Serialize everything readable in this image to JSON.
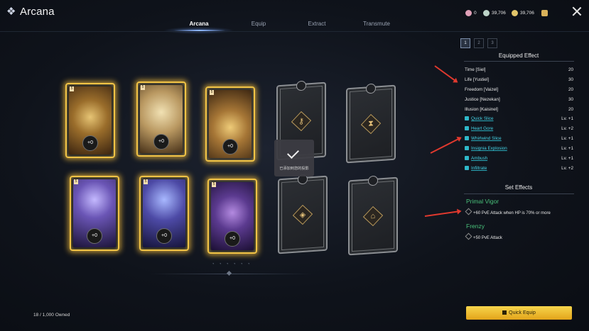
{
  "app": {
    "title": "Arcana"
  },
  "tabs": [
    "Arcana",
    "Equip",
    "Extract",
    "Transmute"
  ],
  "currencies": [
    {
      "icon": "crystal-icon",
      "value": "0",
      "color": "#e0a0b8"
    },
    {
      "icon": "silver-coin-icon",
      "value": "39,706",
      "color": "#bcd3c8"
    },
    {
      "icon": "gold-coin-icon",
      "value": "39,706",
      "color": "#e1c46a"
    },
    {
      "icon": "chest-icon",
      "value": "",
      "color": "#d9b25a"
    }
  ],
  "cards": {
    "row1": [
      {
        "plus": "+0",
        "badge": "5"
      },
      {
        "plus": "+0",
        "badge": "5"
      },
      {
        "plus": "+0",
        "badge": "5"
      }
    ],
    "row2": [
      {
        "plus": "+0",
        "badge": "5"
      },
      {
        "plus": "+0",
        "badge": "5"
      },
      {
        "plus": "+0",
        "badge": "5"
      }
    ]
  },
  "toast": {
    "text": "已添加到您的投影"
  },
  "owned": "18 / 1,000 Owned",
  "panel": {
    "pages": [
      "1",
      "2",
      "3"
    ],
    "equipped_title": "Equipped Effect",
    "stats": [
      {
        "name": "Time [Siel]",
        "value": "20"
      },
      {
        "name": "Life [Yustiel]",
        "value": "30"
      },
      {
        "name": "Freedom [Vaizel]",
        "value": "20"
      },
      {
        "name": "Justice [Nezekan]",
        "value": "30"
      },
      {
        "name": "Illusion [Kaisinel]",
        "value": "20"
      }
    ],
    "skills": [
      {
        "name": "Quick Slice",
        "level": "Lv. +1"
      },
      {
        "name": "Heart Gore",
        "level": "Lv. +2"
      },
      {
        "name": "Whirlwind Slice",
        "level": "Lv. +1"
      },
      {
        "name": "Insignia Explosion",
        "level": "Lv. +1"
      },
      {
        "name": "Ambush",
        "level": "Lv. +1"
      },
      {
        "name": "Infiltrate",
        "level": "Lv. +2"
      }
    ],
    "set_title": "Set Effects",
    "sets": [
      {
        "name": "Primal Vigor",
        "desc": "+60 PvE Attack when HP is 70% or more"
      },
      {
        "name": "Frenzy",
        "desc": "+50 PvE Attack"
      }
    ],
    "quick_equip": "Quick Equip"
  },
  "colors": {
    "accent_gold": "#f2c446",
    "skill_cyan": "#45d4e6",
    "set_green": "#49c27a",
    "arrow_red": "#e0392e"
  }
}
